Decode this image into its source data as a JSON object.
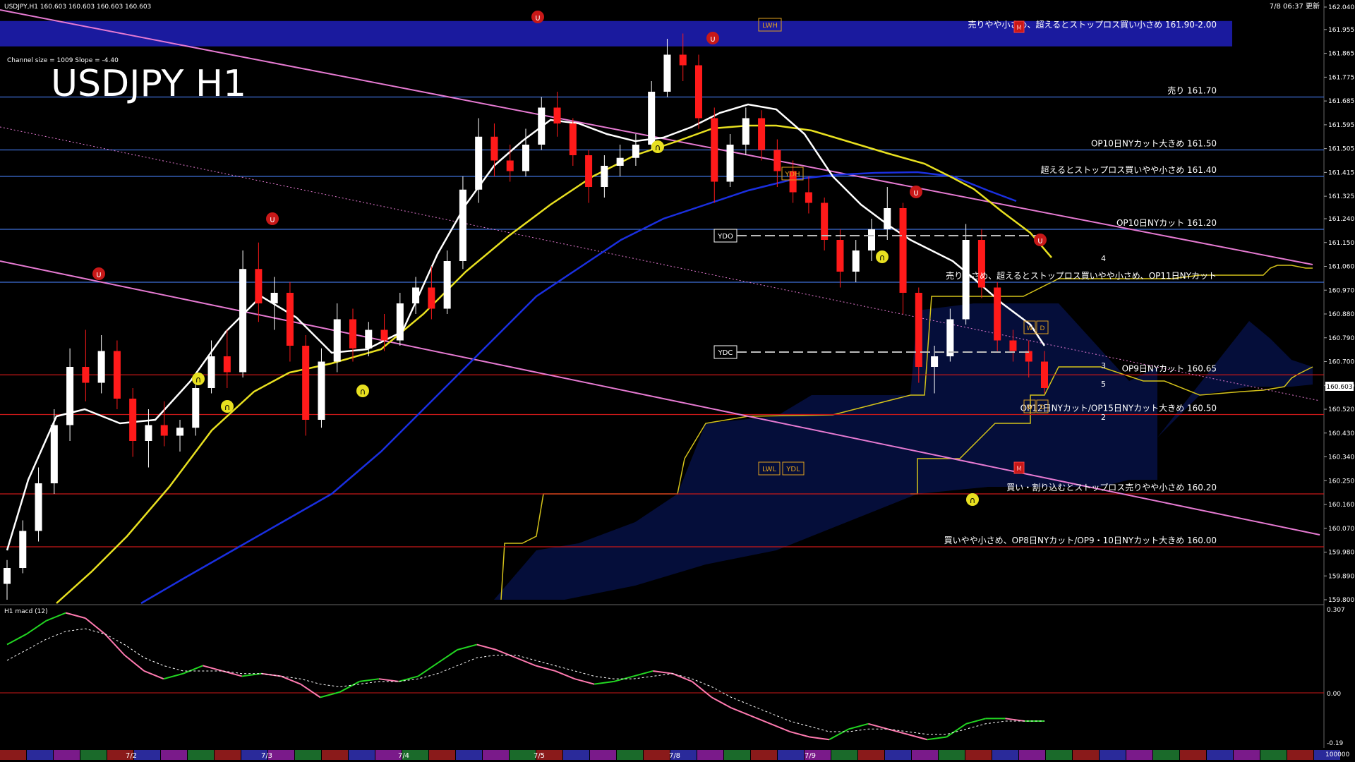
{
  "window": {
    "info_line": "USDJPY,H1  160.603 160.603 160.603 160.603",
    "updated": "7/8 06:37 更新",
    "channel_info": "Channel size = 1009 Slope = -4.40",
    "big_title": "USDJPY H1"
  },
  "macd_panel": {
    "title": "H1  macd (12)",
    "axis_labels": [
      "0.307",
      "0.00",
      "-0.19"
    ]
  },
  "price_axis": {
    "labels": [
      "162.040",
      "161.955",
      "161.865",
      "161.775",
      "161.685",
      "161.595",
      "161.505",
      "161.415",
      "161.325",
      "161.240",
      "161.150",
      "161.060",
      "160.970",
      "160.880",
      "160.790",
      "160.700",
      "160.610",
      "160.520",
      "160.430",
      "160.340",
      "160.250",
      "160.160",
      "160.070",
      "159.980",
      "159.890",
      "159.800"
    ],
    "current_price": "160.603"
  },
  "time_axis": {
    "labels": [
      "7/2",
      "7/3",
      "7/4",
      "7/5",
      "7/8",
      "7/9"
    ],
    "right_label": "100000"
  },
  "markers": {
    "lwh": "LWH",
    "m": "M",
    "ydh": "YDH",
    "ydo": "YDO",
    "ydc": "YDC",
    "lwl": "LWL",
    "ydl": "YDL",
    "w": "W",
    "d": "D"
  },
  "wave_labels": [
    "4",
    "3",
    "5",
    "2"
  ],
  "chart_data": {
    "type": "line",
    "symbol": "USDJPY",
    "timeframe": "H1",
    "y_axis": {
      "min": 159.8,
      "max": 162.04,
      "ticks": [
        162.04,
        161.955,
        161.865,
        161.775,
        161.685,
        161.595,
        161.505,
        161.415,
        161.325,
        161.24,
        161.15,
        161.06,
        160.97,
        160.88,
        160.79,
        160.7,
        160.61,
        160.52,
        160.43,
        160.34,
        160.25,
        160.16,
        160.07,
        159.98,
        159.89,
        159.8
      ]
    },
    "x_categories": [
      "7/2",
      "7/3",
      "7/4",
      "7/5",
      "7/8",
      "7/9"
    ],
    "current_price": 160.603,
    "levels": [
      {
        "price": 161.95,
        "text": "売りやや小さめ、超えるとストップロス買い小さめ 161.90-2.00",
        "color": "#1a1a9e"
      },
      {
        "price": 161.7,
        "text": "売り 161.70",
        "color": "#3f6fd8"
      },
      {
        "price": 161.5,
        "text": "OP10日NYカット大きめ 161.50",
        "color": "#3f6fd8"
      },
      {
        "price": 161.4,
        "text": "超えるとストップロス買いやや小さめ 161.40",
        "color": "#3f6fd8"
      },
      {
        "price": 161.2,
        "text": "OP10日NYカット 161.20",
        "color": "#3f6fd8"
      },
      {
        "price": 161.0,
        "text": "売り小さめ、超えるとストップロス買いやや小さめ、OP11日NYカット",
        "color": "#3f6fd8"
      },
      {
        "price": 160.65,
        "text": "OP9日NYカット 160.65",
        "color": "#c81818"
      },
      {
        "price": 160.5,
        "text": "OP12日NYカット/OP15日NYカット大きめ 160.50",
        "color": "#c81818"
      },
      {
        "price": 160.2,
        "text": "買い・割り込むとストップロス売りやや小さめ 160.20",
        "color": "#c81818"
      },
      {
        "price": 160.0,
        "text": "買いやや小さめ、OP8日NYカット/OP9・10日NYカット大きめ 160.00",
        "color": "#c81818"
      }
    ],
    "candles": [
      {
        "o": 159.86,
        "h": 159.95,
        "l": 159.8,
        "c": 159.92
      },
      {
        "o": 159.92,
        "h": 160.1,
        "l": 159.9,
        "c": 160.06
      },
      {
        "o": 160.06,
        "h": 160.3,
        "l": 160.02,
        "c": 160.24
      },
      {
        "o": 160.24,
        "h": 160.52,
        "l": 160.2,
        "c": 160.46
      },
      {
        "o": 160.46,
        "h": 160.75,
        "l": 160.4,
        "c": 160.68
      },
      {
        "o": 160.68,
        "h": 160.82,
        "l": 160.55,
        "c": 160.62
      },
      {
        "o": 160.62,
        "h": 160.8,
        "l": 160.58,
        "c": 160.74
      },
      {
        "o": 160.74,
        "h": 160.78,
        "l": 160.52,
        "c": 160.56
      },
      {
        "o": 160.56,
        "h": 160.6,
        "l": 160.34,
        "c": 160.4
      },
      {
        "o": 160.4,
        "h": 160.52,
        "l": 160.3,
        "c": 160.46
      },
      {
        "o": 160.46,
        "h": 160.55,
        "l": 160.38,
        "c": 160.42
      },
      {
        "o": 160.42,
        "h": 160.48,
        "l": 160.36,
        "c": 160.45
      },
      {
        "o": 160.45,
        "h": 160.65,
        "l": 160.42,
        "c": 160.6
      },
      {
        "o": 160.6,
        "h": 160.78,
        "l": 160.58,
        "c": 160.72
      },
      {
        "o": 160.72,
        "h": 160.82,
        "l": 160.6,
        "c": 160.66
      },
      {
        "o": 160.66,
        "h": 161.12,
        "l": 160.64,
        "c": 161.05
      },
      {
        "o": 161.05,
        "h": 161.15,
        "l": 160.85,
        "c": 160.92
      },
      {
        "o": 160.92,
        "h": 161.02,
        "l": 160.82,
        "c": 160.96
      },
      {
        "o": 160.96,
        "h": 161.0,
        "l": 160.7,
        "c": 160.76
      },
      {
        "o": 160.76,
        "h": 160.8,
        "l": 160.42,
        "c": 160.48
      },
      {
        "o": 160.48,
        "h": 160.75,
        "l": 160.45,
        "c": 160.7
      },
      {
        "o": 160.7,
        "h": 160.92,
        "l": 160.66,
        "c": 160.86
      },
      {
        "o": 160.86,
        "h": 160.9,
        "l": 160.7,
        "c": 160.75
      },
      {
        "o": 160.75,
        "h": 160.85,
        "l": 160.72,
        "c": 160.82
      },
      {
        "o": 160.82,
        "h": 160.88,
        "l": 160.74,
        "c": 160.78
      },
      {
        "o": 160.78,
        "h": 160.96,
        "l": 160.76,
        "c": 160.92
      },
      {
        "o": 160.92,
        "h": 161.02,
        "l": 160.88,
        "c": 160.98
      },
      {
        "o": 160.98,
        "h": 161.06,
        "l": 160.86,
        "c": 160.9
      },
      {
        "o": 160.9,
        "h": 161.12,
        "l": 160.88,
        "c": 161.08
      },
      {
        "o": 161.08,
        "h": 161.4,
        "l": 161.05,
        "c": 161.35
      },
      {
        "o": 161.35,
        "h": 161.62,
        "l": 161.3,
        "c": 161.55
      },
      {
        "o": 161.55,
        "h": 161.6,
        "l": 161.4,
        "c": 161.46
      },
      {
        "o": 161.46,
        "h": 161.52,
        "l": 161.38,
        "c": 161.42
      },
      {
        "o": 161.42,
        "h": 161.58,
        "l": 161.4,
        "c": 161.52
      },
      {
        "o": 161.52,
        "h": 161.7,
        "l": 161.5,
        "c": 161.66
      },
      {
        "o": 161.66,
        "h": 161.72,
        "l": 161.55,
        "c": 161.6
      },
      {
        "o": 161.6,
        "h": 161.62,
        "l": 161.44,
        "c": 161.48
      },
      {
        "o": 161.48,
        "h": 161.5,
        "l": 161.3,
        "c": 161.36
      },
      {
        "o": 161.36,
        "h": 161.48,
        "l": 161.32,
        "c": 161.44
      },
      {
        "o": 161.44,
        "h": 161.52,
        "l": 161.4,
        "c": 161.47
      },
      {
        "o": 161.47,
        "h": 161.56,
        "l": 161.44,
        "c": 161.52
      },
      {
        "o": 161.52,
        "h": 161.76,
        "l": 161.5,
        "c": 161.72
      },
      {
        "o": 161.72,
        "h": 161.92,
        "l": 161.7,
        "c": 161.86
      },
      {
        "o": 161.86,
        "h": 161.94,
        "l": 161.76,
        "c": 161.82
      },
      {
        "o": 161.82,
        "h": 161.86,
        "l": 161.58,
        "c": 161.62
      },
      {
        "o": 161.62,
        "h": 161.66,
        "l": 161.3,
        "c": 161.38
      },
      {
        "o": 161.38,
        "h": 161.56,
        "l": 161.36,
        "c": 161.52
      },
      {
        "o": 161.52,
        "h": 161.66,
        "l": 161.48,
        "c": 161.62
      },
      {
        "o": 161.62,
        "h": 161.65,
        "l": 161.46,
        "c": 161.5
      },
      {
        "o": 161.5,
        "h": 161.54,
        "l": 161.36,
        "c": 161.42
      },
      {
        "o": 161.42,
        "h": 161.46,
        "l": 161.3,
        "c": 161.34
      },
      {
        "o": 161.34,
        "h": 161.4,
        "l": 161.26,
        "c": 161.3
      },
      {
        "o": 161.3,
        "h": 161.32,
        "l": 161.12,
        "c": 161.16
      },
      {
        "o": 161.16,
        "h": 161.2,
        "l": 160.98,
        "c": 161.04
      },
      {
        "o": 161.04,
        "h": 161.16,
        "l": 161.0,
        "c": 161.12
      },
      {
        "o": 161.12,
        "h": 161.24,
        "l": 161.08,
        "c": 161.2
      },
      {
        "o": 161.2,
        "h": 161.36,
        "l": 161.16,
        "c": 161.28
      },
      {
        "o": 161.28,
        "h": 161.3,
        "l": 160.88,
        "c": 160.96
      },
      {
        "o": 160.96,
        "h": 160.98,
        "l": 160.62,
        "c": 160.68
      },
      {
        "o": 160.68,
        "h": 160.76,
        "l": 160.58,
        "c": 160.72
      },
      {
        "o": 160.72,
        "h": 160.9,
        "l": 160.7,
        "c": 160.86
      },
      {
        "o": 160.86,
        "h": 161.22,
        "l": 160.84,
        "c": 161.16
      },
      {
        "o": 161.16,
        "h": 161.2,
        "l": 160.94,
        "c": 160.98
      },
      {
        "o": 160.98,
        "h": 161.0,
        "l": 160.74,
        "c": 160.78
      },
      {
        "o": 160.78,
        "h": 160.82,
        "l": 160.7,
        "c": 160.74
      },
      {
        "o": 160.74,
        "h": 160.78,
        "l": 160.64,
        "c": 160.7
      },
      {
        "o": 160.7,
        "h": 160.74,
        "l": 160.58,
        "c": 160.6
      }
    ],
    "macd_range": [
      -0.19,
      0.307
    ],
    "macd_main": [
      0.18,
      0.22,
      0.27,
      0.3,
      0.28,
      0.22,
      0.14,
      0.08,
      0.05,
      0.07,
      0.1,
      0.08,
      0.06,
      0.07,
      0.06,
      0.03,
      -0.02,
      0.0,
      0.04,
      0.05,
      0.04,
      0.06,
      0.11,
      0.16,
      0.18,
      0.16,
      0.13,
      0.1,
      0.08,
      0.05,
      0.03,
      0.04,
      0.06,
      0.08,
      0.07,
      0.04,
      -0.02,
      -0.06,
      -0.09,
      -0.12,
      -0.15,
      -0.17,
      -0.18,
      -0.14,
      -0.12,
      -0.14,
      -0.16,
      -0.18,
      -0.17,
      -0.12,
      -0.1,
      -0.1,
      -0.11,
      -0.11
    ],
    "macd_signal": [
      0.12,
      0.16,
      0.2,
      0.23,
      0.24,
      0.22,
      0.18,
      0.13,
      0.1,
      0.08,
      0.08,
      0.08,
      0.07,
      0.07,
      0.06,
      0.05,
      0.03,
      0.02,
      0.03,
      0.04,
      0.04,
      0.05,
      0.07,
      0.1,
      0.13,
      0.14,
      0.14,
      0.12,
      0.1,
      0.08,
      0.06,
      0.05,
      0.05,
      0.06,
      0.07,
      0.05,
      0.02,
      -0.02,
      -0.05,
      -0.08,
      -0.11,
      -0.13,
      -0.15,
      -0.15,
      -0.14,
      -0.14,
      -0.15,
      -0.16,
      -0.16,
      -0.14,
      -0.12,
      -0.11,
      -0.11,
      -0.11
    ]
  }
}
